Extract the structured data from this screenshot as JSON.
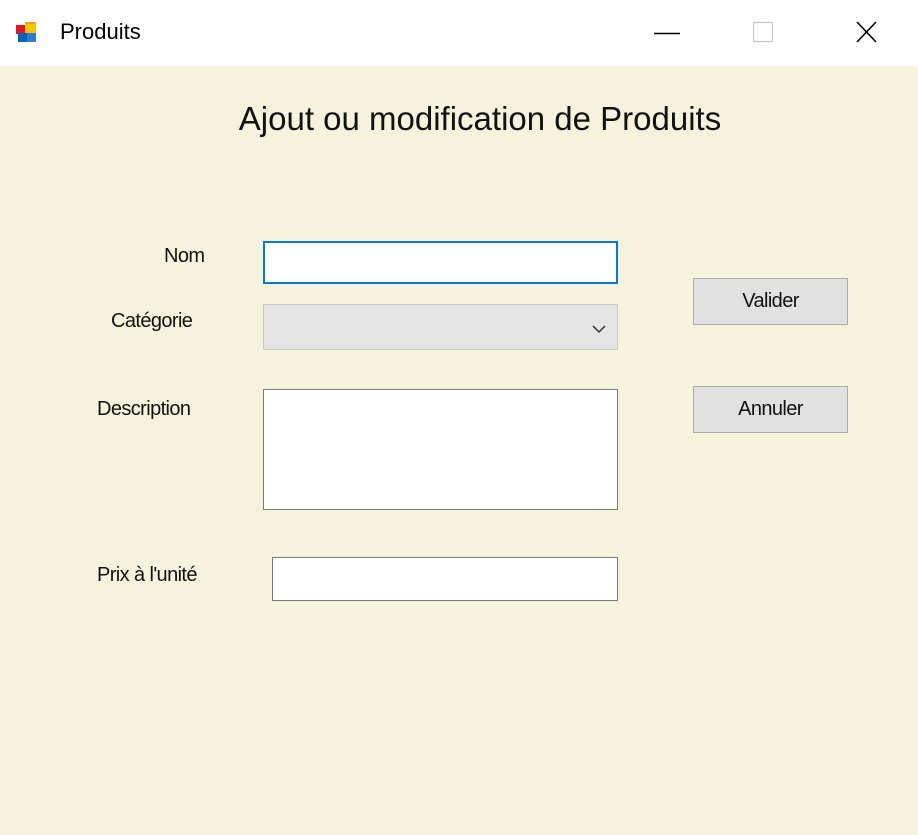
{
  "window": {
    "title": "Produits",
    "app_icon": "windows-forms-app-icon",
    "controls": {
      "minimize_icon": "minimize-icon",
      "maximize_icon": "maximize-icon",
      "close_icon": "close-icon"
    }
  },
  "form": {
    "heading": "Ajout ou modification de Produits",
    "fields": {
      "nom": {
        "label": "Nom",
        "value": ""
      },
      "categorie": {
        "label": "Catégorie",
        "selected": ""
      },
      "description": {
        "label": "Description",
        "value": ""
      },
      "prix": {
        "label": "Prix à l'unité",
        "value": ""
      }
    },
    "buttons": {
      "valider": "Valider",
      "annuler": "Annuler"
    }
  },
  "colors": {
    "form_background": "#f5f3dc",
    "titlebar_background": "#ffffff",
    "focus_border": "#0078d7",
    "button_face": "#e1e1e1"
  }
}
